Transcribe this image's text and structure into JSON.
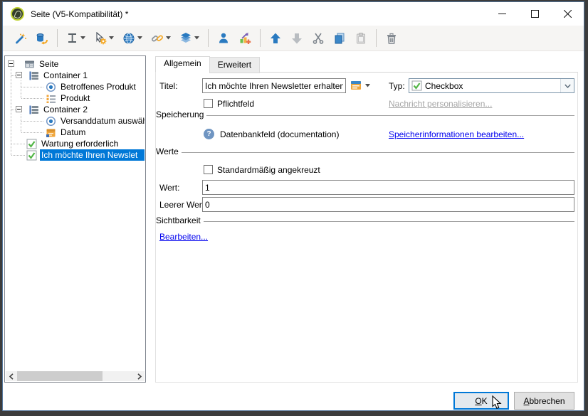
{
  "window": {
    "title": "Seite (V5-Kompatibilität) *",
    "controls": [
      "minimize-icon",
      "maximize-icon",
      "close-icon"
    ]
  },
  "toolbar": {
    "icons": [
      "magic-wand",
      "database-revert",
      "row-height",
      "pointer-settings",
      "globe",
      "hyperlink",
      "layers",
      "person",
      "add-element",
      "move-up",
      "move-down",
      "cut",
      "copy",
      "paste",
      "delete"
    ],
    "dropdown_items": [
      "row-height",
      "pointer-settings",
      "globe",
      "hyperlink",
      "layers"
    ]
  },
  "tree": {
    "items": [
      {
        "label": "Seite",
        "icon": "page",
        "level": 0,
        "expanded": true
      },
      {
        "label": "Container 1",
        "icon": "container",
        "level": 1,
        "expanded": true
      },
      {
        "label": "Betroffenes Produkt",
        "icon": "radio",
        "level": 2
      },
      {
        "label": "Produkt",
        "icon": "list",
        "level": 2
      },
      {
        "label": "Container 2",
        "icon": "container",
        "level": 1,
        "expanded": true
      },
      {
        "label": "Versanddatum auswäh",
        "icon": "radio",
        "level": 2
      },
      {
        "label": "Datum",
        "icon": "calendar",
        "level": 2
      },
      {
        "label": "Wartung erforderlich",
        "icon": "checkbox",
        "level": 1
      },
      {
        "label": "Ich möchte Ihren Newslet",
        "icon": "checkbox",
        "level": 1,
        "selected": true
      }
    ]
  },
  "panel": {
    "tabs": {
      "general": "Allgemein",
      "advanced": "Erweitert"
    },
    "titel_label": "Titel:",
    "titel_value": "Ich möchte Ihren Newsletter erhalten",
    "typ_label": "Typ:",
    "typ_value": "Checkbox",
    "pflichtfeld_label": "Pflichtfeld",
    "nachricht_link": "Nachricht personalisieren...",
    "speicherung_label": "Speicherung",
    "datenbankfeld_text": "Datenbankfeld (documentation)",
    "speicherinfo_link": "Speicherinformationen bearbeiten...",
    "werte_label": "Werte",
    "standard_checkbox_label": "Standardmäßig angekreuzt",
    "wert_label": "Wert:",
    "wert_value": "1",
    "leerer_wert_label": "Leerer Wert:",
    "leerer_wert_value": "0",
    "sichtbarkeit_label": "Sichtbarkeit",
    "bearbeiten_link": "Bearbeiten..."
  },
  "footer": {
    "ok_label": "OK",
    "cancel_label": "Abbrechen"
  },
  "colors": {
    "selection": "#0078d7",
    "link": "#0000ee",
    "focus_border": "#0078d7",
    "check_green": "#52b546"
  }
}
